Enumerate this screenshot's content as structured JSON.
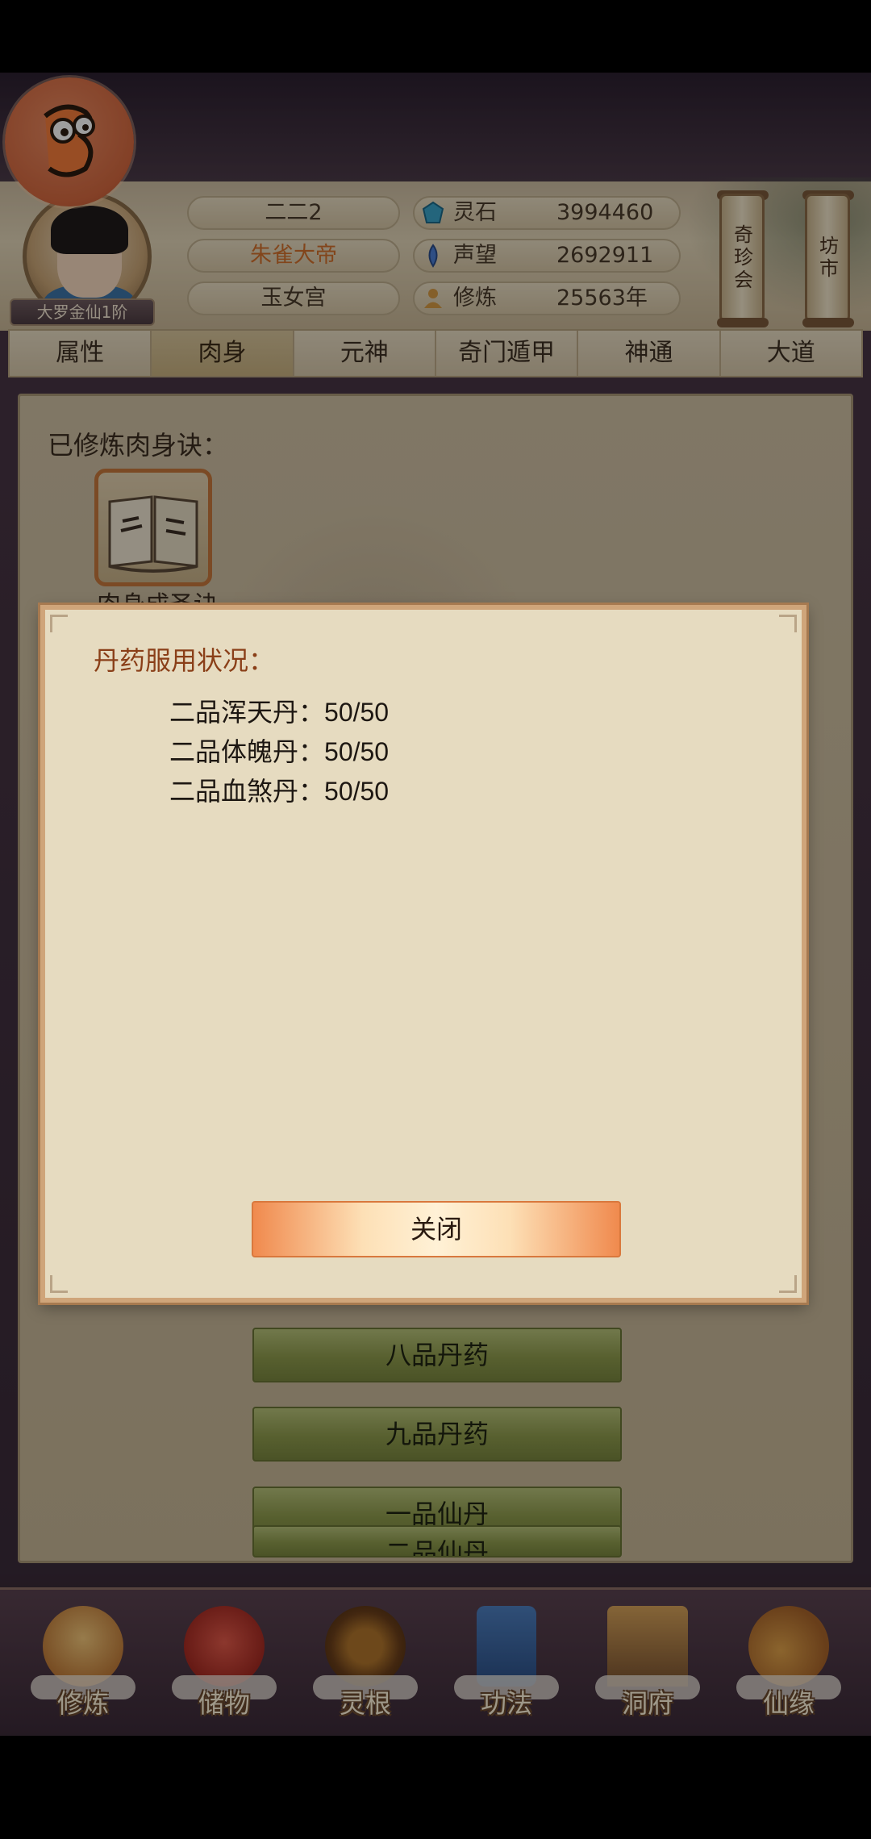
{
  "header": {
    "player_name": "二二2",
    "title": "朱雀大帝",
    "sect": "玉女宫",
    "rank": "大罗金仙1阶",
    "resources": [
      {
        "icon": "spirit-stone-icon",
        "label": "灵石",
        "value": "3994460"
      },
      {
        "icon": "prestige-icon",
        "label": "声望",
        "value": "2692911"
      },
      {
        "icon": "cultivation-icon",
        "label": "修炼",
        "value": "25563年"
      }
    ],
    "side_buttons": [
      {
        "label": "奇珍会"
      },
      {
        "label": "坊市"
      }
    ]
  },
  "tabs": [
    {
      "label": "属性"
    },
    {
      "label": "肉身",
      "active": true
    },
    {
      "label": "元神"
    },
    {
      "label": "奇门遁甲"
    },
    {
      "label": "神通"
    },
    {
      "label": "大道"
    }
  ],
  "panel": {
    "title": "已修炼肉身诀：",
    "book_caption": "肉身成圣诀",
    "list_buttons": [
      "八品丹药",
      "九品丹药",
      "一品仙丹",
      "二品仙丹"
    ]
  },
  "modal": {
    "title": "丹药服用状况：",
    "pills": [
      {
        "name": "二品浑天丹：",
        "count": "50/50"
      },
      {
        "name": "二品体魄丹：",
        "count": "50/50"
      },
      {
        "name": "二品血煞丹：",
        "count": "50/50"
      }
    ],
    "close_label": "关闭"
  },
  "bottom_nav": [
    {
      "label": "修炼",
      "icon": "meditation-icon"
    },
    {
      "label": "储物",
      "icon": "bag-icon"
    },
    {
      "label": "灵根",
      "icon": "spirit-root-icon"
    },
    {
      "label": "功法",
      "icon": "scroll-book-icon"
    },
    {
      "label": "洞府",
      "icon": "cave-dwelling-icon"
    },
    {
      "label": "仙缘",
      "icon": "gourd-icon"
    }
  ]
}
